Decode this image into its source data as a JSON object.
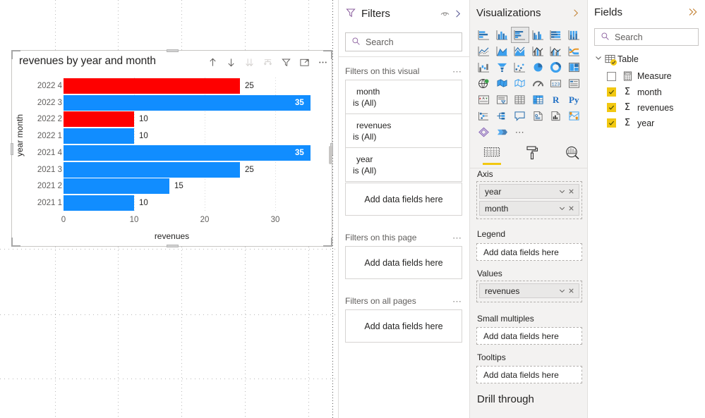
{
  "chart_data": {
    "type": "bar",
    "orientation": "horizontal",
    "title": "revenues by year and month",
    "xlabel": "revenues",
    "ylabel": "year month",
    "xlim": [
      0,
      35
    ],
    "xticks": [
      "0",
      "10",
      "20",
      "30"
    ],
    "xtick_values": [
      0,
      10,
      20,
      30
    ],
    "grid": true,
    "legend": "none",
    "categories": [
      "2022 4",
      "2022 3",
      "2022 2",
      "2022 1",
      "2021 4",
      "2021 3",
      "2021 2",
      "2021 1"
    ],
    "values": [
      25,
      35,
      10,
      10,
      35,
      25,
      15,
      10
    ],
    "labels": [
      "25",
      "35",
      "10",
      "10",
      "35",
      "25",
      "15",
      "10"
    ],
    "label_position": [
      "outside",
      "inside",
      "outside",
      "outside",
      "inside",
      "outside",
      "outside",
      "outside"
    ],
    "bar_colors": [
      "#FE0000",
      "#118DFF",
      "#FE0000",
      "#118DFF",
      "#118DFF",
      "#118DFF",
      "#118DFF",
      "#118DFF"
    ],
    "colors": {
      "default": "#118DFF",
      "highlight": "#FE0000"
    }
  },
  "visual": {
    "title": "revenues by year and month",
    "toolbar": [
      {
        "name": "drill-up-icon",
        "label": "Drill up",
        "state": "enabled"
      },
      {
        "name": "drill-down-icon",
        "label": "Drill down",
        "state": "enabled"
      },
      {
        "name": "expand-all-icon",
        "label": "Go to the next level in the hierarchy",
        "state": "disabled"
      },
      {
        "name": "expand-hierarchy-icon",
        "label": "Expand all down one level in the hierarchy",
        "state": "disabled"
      },
      {
        "name": "filter-icon",
        "label": "Filters",
        "state": "enabled"
      },
      {
        "name": "focus-mode-icon",
        "label": "Focus mode",
        "state": "enabled"
      },
      {
        "name": "more-options-icon",
        "label": "More options",
        "state": "enabled"
      }
    ]
  },
  "filters": {
    "title": "Filters",
    "eye_icon": "hide-filters-icon",
    "collapse_icon": "chevron-right-icon",
    "search": {
      "placeholder": "Search",
      "value": "",
      "icon": "search-icon"
    },
    "sections": [
      {
        "title": "Filters on this visual",
        "menu": "more-options-icon",
        "cards": [
          {
            "field": "month",
            "condition": "is (All)"
          },
          {
            "field": "revenues",
            "condition": "is (All)"
          },
          {
            "field": "year",
            "condition": "is (All)"
          }
        ],
        "dropzone": "Add data fields here"
      },
      {
        "title": "Filters on this page",
        "menu": "more-options-icon",
        "cards": [],
        "dropzone": "Add data fields here"
      },
      {
        "title": "Filters on all pages",
        "menu": "more-options-icon",
        "cards": [],
        "dropzone": "Add data fields here"
      }
    ]
  },
  "visualizations": {
    "title": "Visualizations",
    "collapse_icon": "chevron-right-icon",
    "gallery": [
      {
        "name": "stacked-bar-chart-icon",
        "selected": false
      },
      {
        "name": "stacked-column-chart-icon",
        "selected": false
      },
      {
        "name": "clustered-bar-chart-icon",
        "selected": true
      },
      {
        "name": "clustered-column-chart-icon",
        "selected": false
      },
      {
        "name": "100-percent-stacked-bar-chart-icon",
        "selected": false
      },
      {
        "name": "100-percent-stacked-column-chart-icon",
        "selected": false
      },
      {
        "name": "line-chart-icon",
        "selected": false
      },
      {
        "name": "area-chart-icon",
        "selected": false
      },
      {
        "name": "stacked-area-chart-icon",
        "selected": false
      },
      {
        "name": "line-and-stacked-column-chart-icon",
        "selected": false
      },
      {
        "name": "line-and-clustered-column-chart-icon",
        "selected": false
      },
      {
        "name": "ribbon-chart-icon",
        "selected": false
      },
      {
        "name": "waterfall-chart-icon",
        "selected": false
      },
      {
        "name": "funnel-chart-icon",
        "selected": false
      },
      {
        "name": "scatter-chart-icon",
        "selected": false
      },
      {
        "name": "pie-chart-icon",
        "selected": false
      },
      {
        "name": "donut-chart-icon",
        "selected": false
      },
      {
        "name": "treemap-icon",
        "selected": false
      },
      {
        "name": "map-icon",
        "selected": false
      },
      {
        "name": "filled-map-icon",
        "selected": false
      },
      {
        "name": "shape-map-icon",
        "selected": false
      },
      {
        "name": "gauge-icon",
        "selected": false
      },
      {
        "name": "card-icon",
        "selected": false
      },
      {
        "name": "multi-row-card-icon",
        "selected": false
      },
      {
        "name": "kpi-icon",
        "selected": false
      },
      {
        "name": "slicer-icon",
        "selected": false
      },
      {
        "name": "table-icon",
        "selected": false
      },
      {
        "name": "matrix-icon",
        "selected": false
      },
      {
        "name": "r-script-visual-icon",
        "selected": false,
        "text": "R"
      },
      {
        "name": "python-visual-icon",
        "selected": false,
        "text": "Py"
      },
      {
        "name": "key-influencers-icon",
        "selected": false
      },
      {
        "name": "decomposition-tree-icon",
        "selected": false
      },
      {
        "name": "qna-icon",
        "selected": false
      },
      {
        "name": "smart-narrative-icon",
        "selected": false
      },
      {
        "name": "paginated-report-icon",
        "selected": false
      },
      {
        "name": "arcgis-maps-icon",
        "selected": false
      },
      {
        "name": "power-apps-icon",
        "selected": false
      },
      {
        "name": "power-automate-icon",
        "selected": false
      },
      {
        "name": "get-more-visuals-icon",
        "selected": false
      }
    ],
    "tabs": [
      {
        "name": "fields-tab",
        "icon": "fields-build-icon",
        "active": true
      },
      {
        "name": "format-tab",
        "icon": "paint-roller-icon",
        "active": false
      },
      {
        "name": "analytics-tab",
        "icon": "magnifier-analytics-icon",
        "active": false
      }
    ],
    "wells": [
      {
        "label": "Axis",
        "fields": [
          {
            "name": "year",
            "dropdown_icon": "chevron-down-icon",
            "remove_icon": "close-icon"
          },
          {
            "name": "month",
            "dropdown_icon": "chevron-down-icon",
            "remove_icon": "close-icon"
          }
        ],
        "placeholder": ""
      },
      {
        "label": "Legend",
        "fields": [],
        "placeholder": "Add data fields here"
      },
      {
        "label": "Values",
        "fields": [
          {
            "name": "revenues",
            "dropdown_icon": "chevron-down-icon",
            "remove_icon": "close-icon"
          }
        ],
        "placeholder": ""
      },
      {
        "label": "Small multiples",
        "fields": [],
        "placeholder": "Add data fields here"
      },
      {
        "label": "Tooltips",
        "fields": [],
        "placeholder": "Add data fields here"
      }
    ],
    "drill_through_title": "Drill through"
  },
  "fields": {
    "title": "Fields",
    "collapse_icon": "double-chevron-right-icon",
    "search": {
      "placeholder": "Search",
      "value": "",
      "icon": "search-icon"
    },
    "table": {
      "name": "Table",
      "expand_icon": "chevron-down-icon",
      "table_icon": "table-icon",
      "items": [
        {
          "name": "Measure",
          "checked": false,
          "icon": "calculator-icon"
        },
        {
          "name": "month",
          "checked": true,
          "icon": "sigma-icon"
        },
        {
          "name": "revenues",
          "checked": true,
          "icon": "sigma-icon"
        },
        {
          "name": "year",
          "checked": true,
          "icon": "sigma-icon"
        }
      ]
    }
  }
}
